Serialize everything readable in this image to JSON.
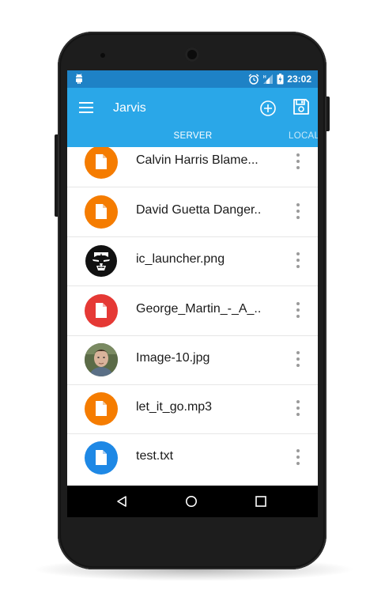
{
  "status_bar": {
    "time": "23:02"
  },
  "app_bar": {
    "title": "Jarvis",
    "icons": [
      "menu-icon",
      "add-circle-icon",
      "save-icon"
    ]
  },
  "tabs": [
    {
      "label": "SERVER",
      "selected": true
    },
    {
      "label": "LOCAL",
      "selected": false
    }
  ],
  "files": [
    {
      "name": "Calvin Harris Blame...",
      "icon": "file-icon",
      "color": "#f57c00"
    },
    {
      "name": "David Guetta Danger..",
      "icon": "file-icon",
      "color": "#f57c00"
    },
    {
      "name": "ic_launcher.png",
      "icon": "ironman-thumbnail"
    },
    {
      "name": "George_Martin_-_A_..",
      "icon": "file-icon",
      "color": "#e53935"
    },
    {
      "name": "Image-10.jpg",
      "icon": "photo-thumbnail"
    },
    {
      "name": "let_it_go.mp3",
      "icon": "file-icon",
      "color": "#f57c00"
    },
    {
      "name": "test.txt",
      "icon": "file-icon",
      "color": "#1e88e5"
    }
  ],
  "fab": {
    "icon": "plus-icon"
  },
  "colors": {
    "status_bar": "#1e82c6",
    "app_bar": "#2aa7e8",
    "orange": "#f57c00",
    "red": "#e53935",
    "blue": "#1e88e5"
  }
}
